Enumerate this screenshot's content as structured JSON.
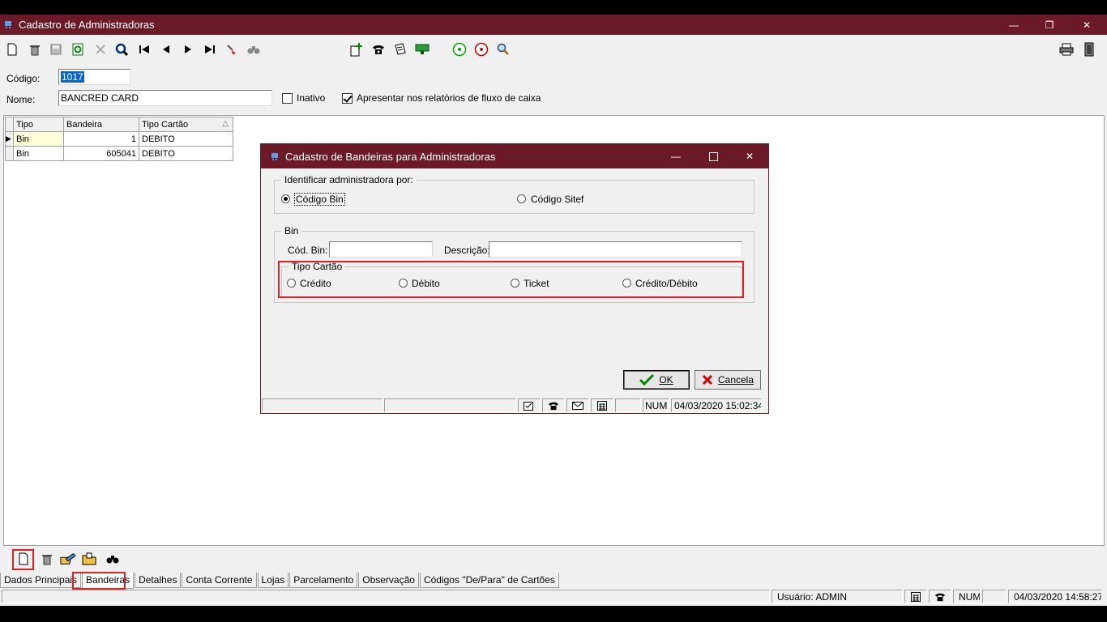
{
  "window": {
    "title": "Cadastro de Administradoras",
    "controls": {
      "minimize": "—",
      "restore": "❐",
      "close": "✕"
    }
  },
  "toolbar": {
    "icons": [
      "new-file-icon",
      "trash-icon",
      "save-icon",
      "refresh-icon",
      "cancel-icon",
      "search-icon",
      "first-record-icon",
      "previous-record-icon",
      "next-record-icon",
      "last-record-icon",
      "filter-icon",
      "binoculars-icon",
      "add-document-icon",
      "phone-icon",
      "notes-icon",
      "money-icon",
      "circle-green-icon",
      "circle-red-icon",
      "zoom-icon",
      "printer-icon",
      "exit-icon"
    ]
  },
  "form": {
    "codigo_label": "Código:",
    "codigo_value": "1017",
    "nome_label": "Nome:",
    "nome_value": "BANCRED CARD",
    "inativo_label": "Inativo",
    "inativo_checked": false,
    "fluxo_label": "Apresentar nos relatórios de fluxo de caixa",
    "fluxo_checked": true
  },
  "grid": {
    "columns": [
      "Tipo",
      "Bandeira",
      "Tipo Cartão"
    ],
    "rows": [
      {
        "tipo": "Bin",
        "bandeira": "1",
        "tipo_cartao": "DEBITO"
      },
      {
        "tipo": "Bin",
        "bandeira": "605041",
        "tipo_cartao": "DEBITO"
      }
    ]
  },
  "tabs": [
    {
      "label": "Dados Principais"
    },
    {
      "label": "Bandeiras"
    },
    {
      "label": "Detalhes"
    },
    {
      "label": "Conta Corrente"
    },
    {
      "label": "Lojas"
    },
    {
      "label": "Parcelamento"
    },
    {
      "label": "Observação"
    },
    {
      "label": "Códigos \"De/Para\" de Cartões"
    }
  ],
  "statusbar": {
    "usuario": "Usuário: ADMIN",
    "num": "NUM",
    "datetime": "04/03/2020 14:58:27"
  },
  "dialog": {
    "title": "Cadastro de Bandeiras para Administradoras",
    "identificar_legend": "Identificar administradora por:",
    "radio_codigo_bin": "Código Bin",
    "radio_codigo_sitef": "Código Sitef",
    "bin_legend": "Bin",
    "cod_bin_label": "Cód. Bin:",
    "cod_bin_value": "",
    "descricao_label": "Descrição:",
    "descricao_value": "",
    "tipo_cartao_legend": "Tipo Cartão",
    "tipo_options": [
      "Crédito",
      "Débito",
      "Ticket",
      "Crédito/Débito"
    ],
    "ok_label": "OK",
    "cancel_label": "Cancela",
    "status_num": "NUM",
    "status_datetime": "04/03/2020 15:02:34"
  },
  "colors": {
    "titlebar": "#6b1a2a",
    "highlight": "#e0202a",
    "selection": "#0a64c8"
  }
}
